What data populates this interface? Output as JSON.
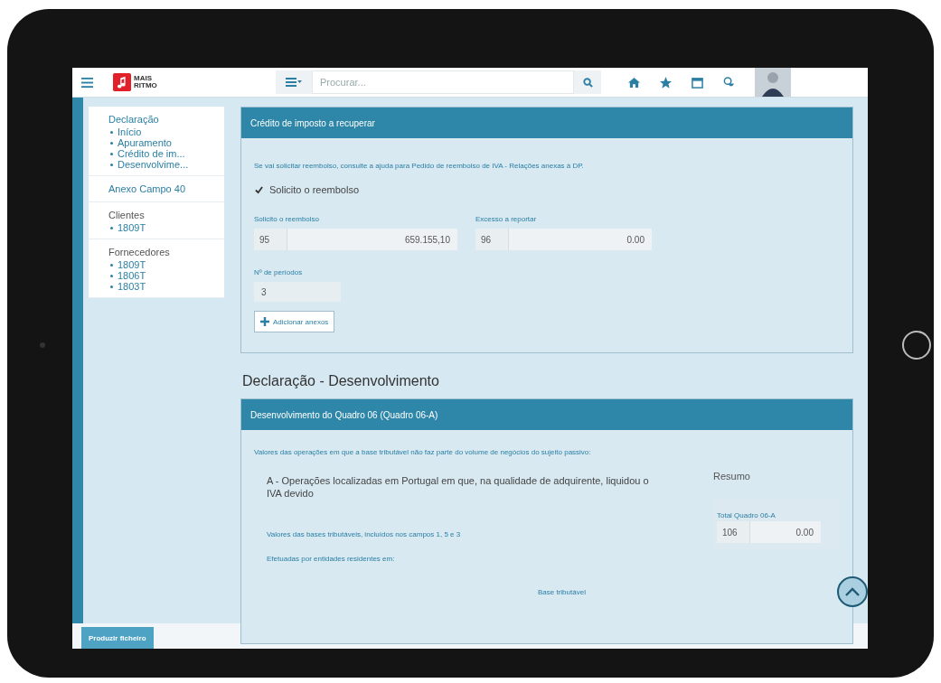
{
  "topbar": {
    "search": {
      "placeholder": "Procurar..."
    },
    "logo": {
      "line_1": "MAIS",
      "line_2": "RITMO"
    }
  },
  "sidebar": {
    "sections": [
      {
        "title": "Declaração",
        "items": [
          "Início",
          "Apuramento",
          "Crédito de im...",
          "Desenvolvime..."
        ]
      },
      {
        "title": "Anexo Campo 40"
      },
      {
        "title": "Clientes",
        "items": [
          "1809T"
        ]
      },
      {
        "title": "Fornecedores",
        "items": [
          "1809T",
          "1806T",
          "1803T"
        ]
      }
    ]
  },
  "credit_panel": {
    "title": "Crédito de imposto a recuperar",
    "note": "Se vai solicitar reembolso, consulte a ajuda para Pedido de reembolso de IVA - Relações anexas à DP.",
    "checkbox": {
      "label": "Solicito o reembolso",
      "checked": true
    },
    "fields": [
      {
        "label": "Solicito o reembolso",
        "code": "95",
        "value": "659.155,10"
      },
      {
        "label": "Excesso a reportar",
        "code": "96",
        "value": "0.00"
      }
    ],
    "periods": {
      "label": "Nº de períodos",
      "value": "3"
    },
    "button": "Adicionar anexos"
  },
  "heading": "Declaração - Desenvolvimento",
  "development_panel": {
    "title": "Desenvolvimento do Quadro 06 (Quadro 06-A)",
    "note": "Valores das operações em que a base tributável não faz parte do volume de negócios do sujeito passivo:",
    "section_title": "A - Operações localizadas em Portugal em que, na qualidade de adquirente, liquidou o IVA devido",
    "lines": [
      "Valores das bases tributáveis, incluídos nos campos 1, 5 e 3",
      "Efetuadas por entidades residentes em:"
    ],
    "column_header": "Base tributável",
    "summary": {
      "title": "Resumo",
      "label": "Total Quadro 06-A",
      "code": "106",
      "value": "0.00"
    }
  },
  "footer_button": "Produzir ficheiro"
}
